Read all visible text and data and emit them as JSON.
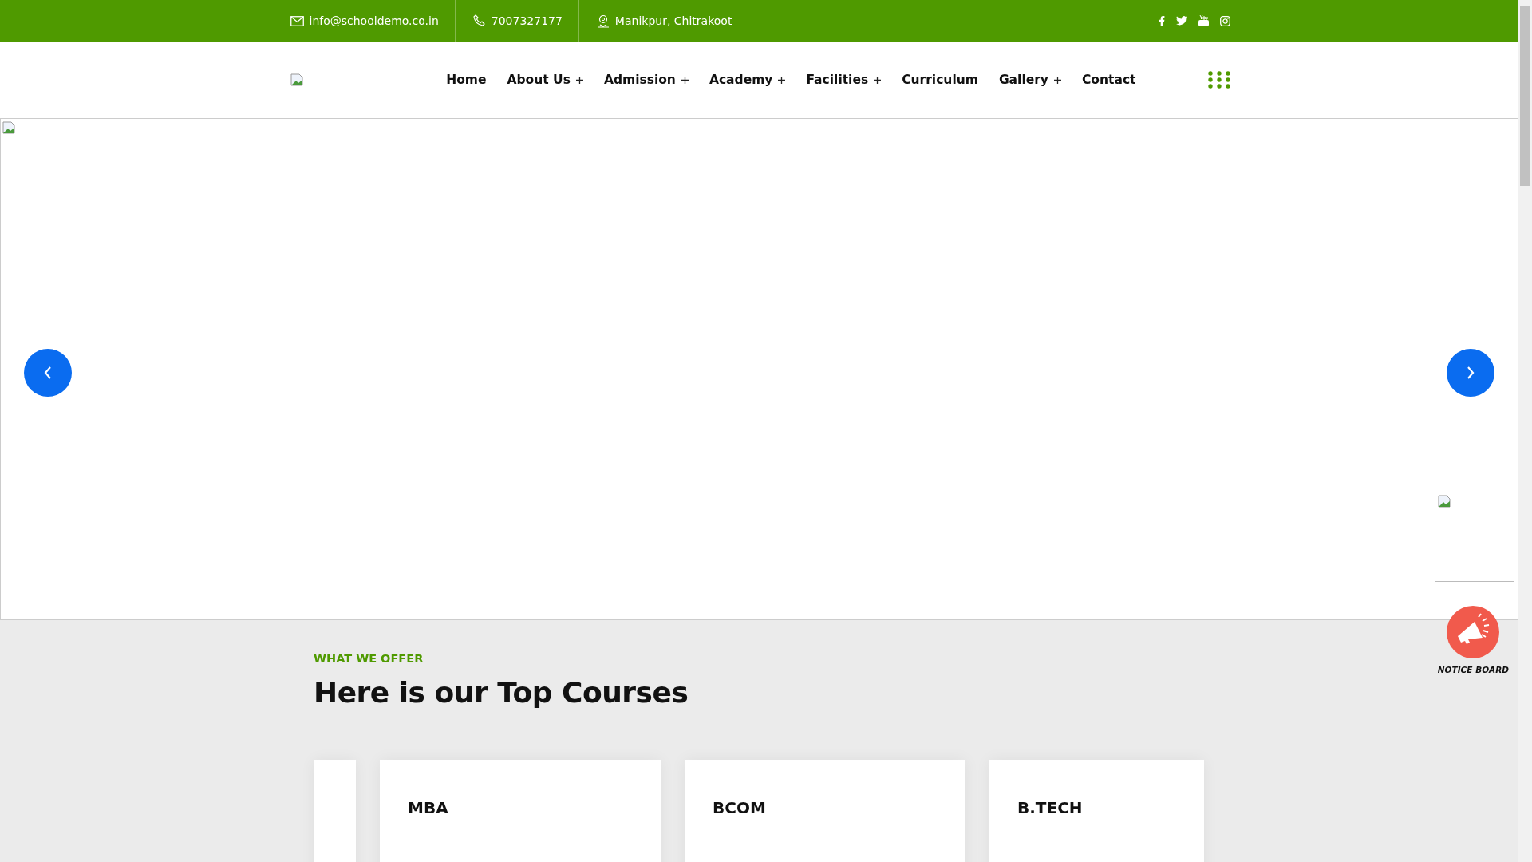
{
  "top_bar": {
    "email": "info@schooldemo.co.in",
    "phone": "7007327177",
    "location": "Manikpur, Chitrakoot"
  },
  "nav": [
    {
      "label": "Home",
      "has_submenu": false
    },
    {
      "label": "About Us",
      "has_submenu": true
    },
    {
      "label": "Admission",
      "has_submenu": true
    },
    {
      "label": "Academy",
      "has_submenu": true
    },
    {
      "label": "Facilities",
      "has_submenu": true
    },
    {
      "label": "Curriculum",
      "has_submenu": false
    },
    {
      "label": "Gallery",
      "has_submenu": true
    },
    {
      "label": "Contact",
      "has_submenu": false
    }
  ],
  "notice_board": {
    "label": "NOTICE BOARD"
  },
  "courses": {
    "eyebrow": "WHAT WE OFFER",
    "title": "Here is our Top Courses",
    "cards": [
      {
        "kind": "stub"
      },
      {
        "kind": "full",
        "title": "MBA"
      },
      {
        "kind": "full",
        "title": "BCOM"
      },
      {
        "kind": "full",
        "title": "B.TECH"
      }
    ]
  }
}
